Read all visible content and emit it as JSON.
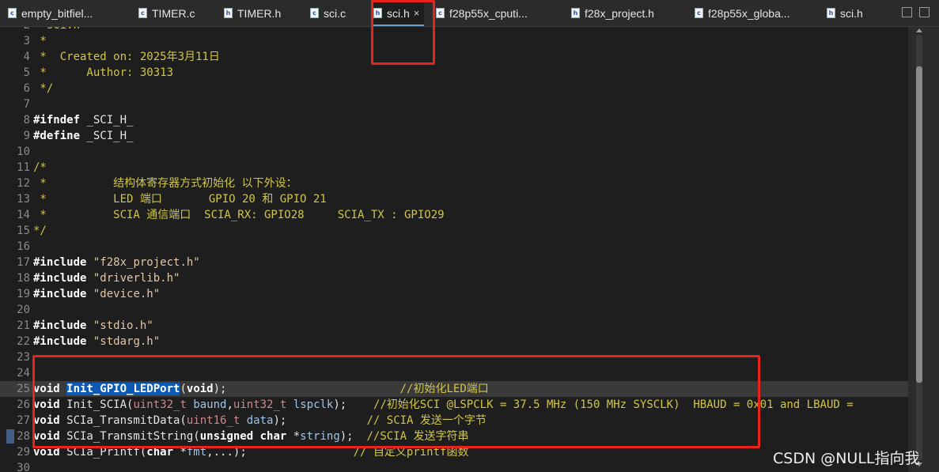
{
  "tabs": [
    {
      "label": "empty_bitfiel...",
      "icon": "c-file-icon",
      "letter": "c"
    },
    {
      "label": "TIMER.c",
      "icon": "c-file-icon",
      "letter": "c"
    },
    {
      "label": "TIMER.h",
      "icon": "h-file-icon",
      "letter": "h"
    },
    {
      "label": "sci.c",
      "icon": "c-file-icon",
      "letter": "c"
    },
    {
      "label": "sci.h",
      "icon": "h-file-icon",
      "letter": "h",
      "active": true,
      "close": "×"
    },
    {
      "label": "f28p55x_cputi...",
      "icon": "c-file-icon",
      "letter": "c"
    },
    {
      "label": "f28x_project.h",
      "icon": "h-file-icon",
      "letter": "h"
    },
    {
      "label": "f28p55x_globa...",
      "icon": "c-file-icon",
      "letter": "c"
    },
    {
      "label": "sci.h",
      "icon": "h-file-icon",
      "letter": "h"
    }
  ],
  "lines": [
    {
      "n": "2",
      "t": [
        [
          "cmt",
          "  sci.h"
        ]
      ]
    },
    {
      "n": "3",
      "t": [
        [
          "cmt",
          " *"
        ]
      ]
    },
    {
      "n": "4",
      "t": [
        [
          "cmt",
          " *  Created on: 2025年3月11日"
        ]
      ]
    },
    {
      "n": "5",
      "t": [
        [
          "cmt",
          " *      Author: 30313"
        ]
      ]
    },
    {
      "n": "6",
      "t": [
        [
          "cmt",
          " */"
        ]
      ]
    },
    {
      "n": "7",
      "t": []
    },
    {
      "n": "8",
      "t": [
        [
          "kw",
          "#ifndef"
        ],
        [
          "fn",
          " _SCI_H_"
        ]
      ]
    },
    {
      "n": "9",
      "t": [
        [
          "kw",
          "#define"
        ],
        [
          "fn",
          " _SCI_H_"
        ]
      ]
    },
    {
      "n": "10",
      "t": []
    },
    {
      "n": "11",
      "t": [
        [
          "cmt",
          "/*"
        ]
      ]
    },
    {
      "n": "12",
      "t": [
        [
          "cmt",
          " *          结构体寄存器方式初始化 以下外设："
        ]
      ]
    },
    {
      "n": "13",
      "t": [
        [
          "cmt",
          " *          LED 端口       GPIO 20 和 GPIO 21"
        ]
      ]
    },
    {
      "n": "14",
      "t": [
        [
          "cmt",
          " *          SCIA 通信端口  SCIA_RX: GPIO28     SCIA_TX : GPIO29"
        ]
      ]
    },
    {
      "n": "15",
      "t": [
        [
          "cmt",
          "*/"
        ]
      ]
    },
    {
      "n": "16",
      "t": []
    },
    {
      "n": "17",
      "t": [
        [
          "kw",
          "#include"
        ],
        [
          "str",
          " \"f28x_project.h\""
        ]
      ]
    },
    {
      "n": "18",
      "t": [
        [
          "kw",
          "#include"
        ],
        [
          "str",
          " \"driverlib.h\""
        ]
      ]
    },
    {
      "n": "19",
      "t": [
        [
          "kw",
          "#include"
        ],
        [
          "str",
          " \"device.h\""
        ]
      ]
    },
    {
      "n": "20",
      "t": []
    },
    {
      "n": "21",
      "t": [
        [
          "kw",
          "#include"
        ],
        [
          "str",
          " \"stdio.h\""
        ]
      ]
    },
    {
      "n": "22",
      "t": [
        [
          "kw",
          "#include"
        ],
        [
          "str",
          " \"stdarg.h\""
        ]
      ]
    },
    {
      "n": "23",
      "t": []
    },
    {
      "n": "24",
      "t": []
    },
    {
      "n": "25",
      "hl": true,
      "t": [
        [
          "kw",
          "void"
        ],
        [
          "fn",
          " "
        ],
        [
          "fnhl",
          "Init_GPIO_LEDPort"
        ],
        [
          "fn",
          "("
        ],
        [
          "kw",
          "void"
        ],
        [
          "fn",
          ");"
        ],
        [
          "fn",
          "                          "
        ],
        [
          "lc",
          "//初始化LED端口"
        ]
      ]
    },
    {
      "n": "26",
      "t": [
        [
          "kw",
          "void"
        ],
        [
          "fn",
          " Init_SCIA("
        ],
        [
          "typ",
          "uint32_t"
        ],
        [
          "fn",
          " "
        ],
        [
          "par",
          "baund"
        ],
        [
          "fn",
          ","
        ],
        [
          "typ",
          "uint32_t"
        ],
        [
          "fn",
          " "
        ],
        [
          "par",
          "lspclk"
        ],
        [
          "fn",
          ");    "
        ],
        [
          "lc",
          "//初始化SCI @LSPCLK = 37.5 MHz (150 MHz SYSCLK)  HBAUD = 0x01 and LBAUD ="
        ]
      ]
    },
    {
      "n": "27",
      "t": [
        [
          "kw",
          "void"
        ],
        [
          "fn",
          " SCIa_TransmitData("
        ],
        [
          "typ",
          "uint16_t"
        ],
        [
          "fn",
          " "
        ],
        [
          "par",
          "data"
        ],
        [
          "fn",
          ");            "
        ],
        [
          "lc",
          "// SCIA 发送一个字节"
        ]
      ]
    },
    {
      "n": "28",
      "mark": true,
      "t": [
        [
          "kw",
          "void"
        ],
        [
          "fn",
          " SCIa_TransmitString("
        ],
        [
          "kw",
          "unsigned char"
        ],
        [
          "fn",
          " *"
        ],
        [
          "par",
          "string"
        ],
        [
          "fn",
          ");  "
        ],
        [
          "lc",
          "//SCIA 发送字符串"
        ]
      ]
    },
    {
      "n": "29",
      "t": [
        [
          "kw",
          "void"
        ],
        [
          "fn",
          " SCIa_Printf("
        ],
        [
          "kw",
          "char"
        ],
        [
          "fn",
          " *"
        ],
        [
          "par",
          "fmt"
        ],
        [
          "fn",
          ",...);                "
        ],
        [
          "lc",
          "// 自定义printf函数"
        ]
      ]
    },
    {
      "n": "30",
      "t": []
    }
  ],
  "watermark": "CSDN @NULL指向我",
  "colors": {
    "annotation": "#e8231b",
    "selection": "#0b5ab5"
  }
}
